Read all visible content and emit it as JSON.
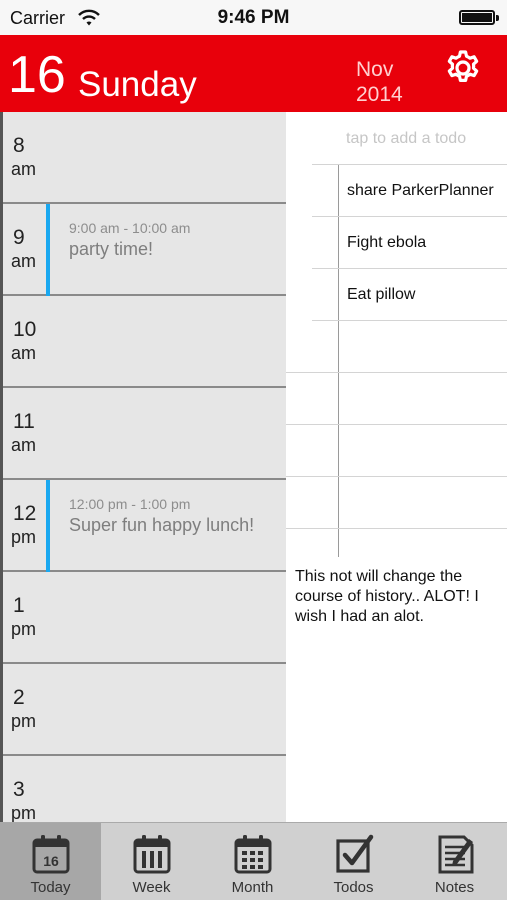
{
  "status_bar": {
    "carrier": "Carrier",
    "time": "9:46 PM"
  },
  "header": {
    "day_number": "16",
    "day_name": "Sunday",
    "month": "Nov",
    "year": "2014",
    "settings_icon": "gear-icon",
    "accent_color": "#e8000b"
  },
  "schedule": {
    "rows": [
      {
        "hour": "8",
        "ampm": "am"
      },
      {
        "hour": "9",
        "ampm": "am",
        "event_time": "9:00 am - 10:00 am",
        "event_title": "party time!"
      },
      {
        "hour": "10",
        "ampm": "am"
      },
      {
        "hour": "11",
        "ampm": "am"
      },
      {
        "hour": "12",
        "ampm": "pm",
        "event_time": "12:00 pm - 1:00 pm",
        "event_title": "Super fun happy lunch!"
      },
      {
        "hour": "1",
        "ampm": "pm"
      },
      {
        "hour": "2",
        "ampm": "pm"
      },
      {
        "hour": "3",
        "ampm": "pm"
      }
    ],
    "event_color": "#1aa8f0"
  },
  "todos": {
    "placeholder": "tap to add a todo",
    "items": [
      "share ParkerPlanner",
      "Fight ebola",
      "Eat pillow"
    ]
  },
  "notes": {
    "text": "This not will change the course of history.. ALOT! I wish I had an alot."
  },
  "tabbar": {
    "tabs": [
      {
        "label": "Today",
        "icon": "calendar-day-icon",
        "badge": "16",
        "active": true
      },
      {
        "label": "Week",
        "icon": "calendar-week-icon"
      },
      {
        "label": "Month",
        "icon": "calendar-month-icon"
      },
      {
        "label": "Todos",
        "icon": "checkbox-icon"
      },
      {
        "label": "Notes",
        "icon": "notes-icon"
      }
    ]
  }
}
